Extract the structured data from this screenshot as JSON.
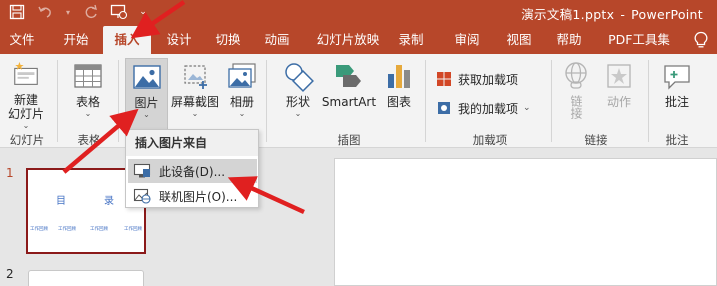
{
  "titlebar": {
    "doc_name": "演示文稿1.pptx",
    "separator": "-",
    "app_name": "PowerPoint"
  },
  "tabs": [
    {
      "label": "文件"
    },
    {
      "label": "开始"
    },
    {
      "label": "插入"
    },
    {
      "label": "设计"
    },
    {
      "label": "切换"
    },
    {
      "label": "动画"
    },
    {
      "label": "幻灯片放映"
    },
    {
      "label": "录制"
    },
    {
      "label": "审阅"
    },
    {
      "label": "视图"
    },
    {
      "label": "帮助"
    },
    {
      "label": "PDF工具集"
    }
  ],
  "active_tab": "插入",
  "ribbon": {
    "slides_group": {
      "button": [
        "新建",
        "幻灯片"
      ],
      "label": "幻灯片"
    },
    "table_group": {
      "button": "表格",
      "label": "表格"
    },
    "image_group": {
      "picture": "图片",
      "screenshot": "屏幕截图",
      "album": "相册"
    },
    "illustrations_group": {
      "shapes": "形状",
      "smartart": "SmartArt",
      "chart": "图表",
      "label": "插图"
    },
    "addins_group": {
      "get_addins": "获取加载项",
      "my_addins": "我的加载项",
      "label": "加载项"
    },
    "links_group": {
      "link": "链接",
      "action": "动作",
      "label": "链接"
    },
    "comments_group": {
      "comment": "批注",
      "label": "批注"
    }
  },
  "dropdown": {
    "header": "插入图片来自",
    "items": [
      {
        "label": "此设备(D)..."
      },
      {
        "label": "联机图片(O)..."
      }
    ]
  },
  "slides": {
    "numbers": [
      "1",
      "2"
    ],
    "thumb1": {
      "title_left": "目",
      "title_right": "录",
      "items": [
        "工作回顾",
        "工作回顾",
        "工作回顾",
        "工作回顾"
      ]
    }
  },
  "colors": {
    "accent": "#b7472a",
    "ribbon_bg": "#f3f3f3",
    "arrow": "#e02020"
  }
}
